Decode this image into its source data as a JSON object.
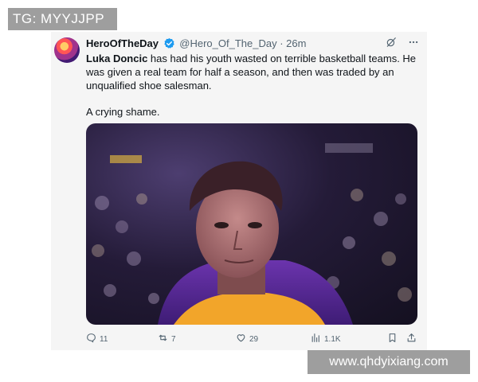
{
  "overlay_top": {
    "text": "TG: MYYJJPP"
  },
  "overlay_bottom": {
    "text": "www.qhdyixiang.com"
  },
  "tweet": {
    "display_name": "HeroOfTheDay",
    "handle": "@Hero_Of_The_Day",
    "separator": " · ",
    "time": "26m",
    "mention": "Luka Doncic",
    "text_line1_rest": " has had his youth wasted on terrible basketball teams. He was given a real team for half a season, and then was traded by an unqualified shoe salesman.",
    "text_line2": "A crying shame.",
    "icons": {
      "verified": "verified-badge-icon",
      "grok": "grok-icon",
      "more": "more-options-icon"
    }
  },
  "actions": {
    "replies": "11",
    "reposts": "7",
    "likes": "29",
    "views": "1.1K"
  },
  "colors": {
    "card_bg": "#f5f5f5",
    "verified": "#1d9bf0",
    "text": "#0f1419",
    "secondary": "#536471"
  }
}
